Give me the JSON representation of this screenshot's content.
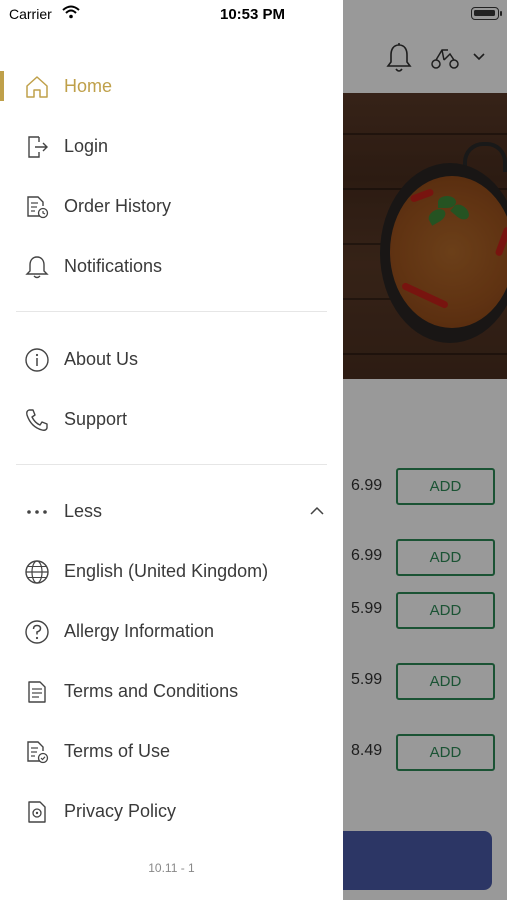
{
  "status_bar": {
    "carrier": "Carrier",
    "time": "10:53 PM"
  },
  "background": {
    "items": [
      {
        "price": "6.99",
        "add_label": "ADD"
      },
      {
        "price": "6.99",
        "add_label": "ADD"
      },
      {
        "price": "5.99",
        "add_label": "ADD"
      },
      {
        "price": "5.99",
        "add_label": "ADD"
      },
      {
        "price": "8.49",
        "add_label": "ADD"
      }
    ]
  },
  "drawer": {
    "accent_color": "#bfa04a",
    "primary": [
      {
        "label": "Home",
        "icon": "home-icon",
        "active": true
      },
      {
        "label": "Login",
        "icon": "login-icon"
      },
      {
        "label": "Order History",
        "icon": "order-history-icon"
      },
      {
        "label": "Notifications",
        "icon": "bell-icon"
      }
    ],
    "secondary": [
      {
        "label": "About Us",
        "icon": "info-icon"
      },
      {
        "label": "Support",
        "icon": "phone-icon"
      }
    ],
    "more_toggle": {
      "label": "Less",
      "icon": "more-dots-icon"
    },
    "extra": [
      {
        "label": "English (United Kingdom)",
        "icon": "globe-icon"
      },
      {
        "label": "Allergy Information",
        "icon": "question-icon"
      },
      {
        "label": "Terms and Conditions",
        "icon": "document-icon"
      },
      {
        "label": "Terms of Use",
        "icon": "document-check-icon"
      },
      {
        "label": "Privacy Policy",
        "icon": "privacy-icon"
      }
    ],
    "version": "10.11 - 1"
  }
}
